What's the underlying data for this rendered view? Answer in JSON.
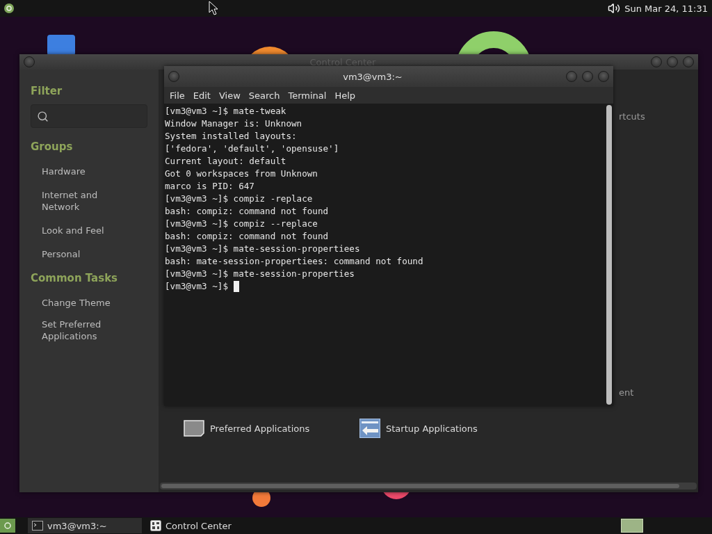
{
  "top_panel": {
    "clock": "Sun Mar 24, 11:31"
  },
  "control_center": {
    "title": "Control Center",
    "sidebar": {
      "filter_heading": "Filter",
      "groups_heading": "Groups",
      "groups": [
        "Hardware",
        "Internet and Network",
        "Look and Feel",
        "Personal"
      ],
      "tasks_heading": "Common Tasks",
      "tasks": [
        "Change Theme",
        "Set Preferred Applications"
      ]
    },
    "partial_texts": [
      "rtcuts",
      "ent"
    ],
    "items": [
      {
        "label": "Preferred Applications",
        "kind": "preferred"
      },
      {
        "label": "Startup Applications",
        "kind": "startup"
      }
    ]
  },
  "terminal": {
    "title": "vm3@vm3:~",
    "menu": [
      "File",
      "Edit",
      "View",
      "Search",
      "Terminal",
      "Help"
    ],
    "lines": [
      "[vm3@vm3 ~]$ mate-tweak",
      "Window Manager is: Unknown",
      "System installed layouts:",
      "['fedora', 'default', 'opensuse']",
      "Current layout: default",
      "Got 0 workspaces from Unknown",
      "marco is PID: 647",
      "[vm3@vm3 ~]$ compiz -replace",
      "bash: compiz: command not found",
      "[vm3@vm3 ~]$ compiz --replace",
      "bash: compiz: command not found",
      "[vm3@vm3 ~]$ mate-session-propertiees",
      "bash: mate-session-propertiees: command not found",
      "[vm3@vm3 ~]$ mate-session-properties",
      "[vm3@vm3 ~]$ "
    ],
    "cursor": true
  },
  "taskbar": {
    "tasks": [
      {
        "label": "vm3@vm3:~",
        "kind": "terminal",
        "selected": true
      },
      {
        "label": "Control Center",
        "kind": "control",
        "selected": false
      }
    ]
  }
}
